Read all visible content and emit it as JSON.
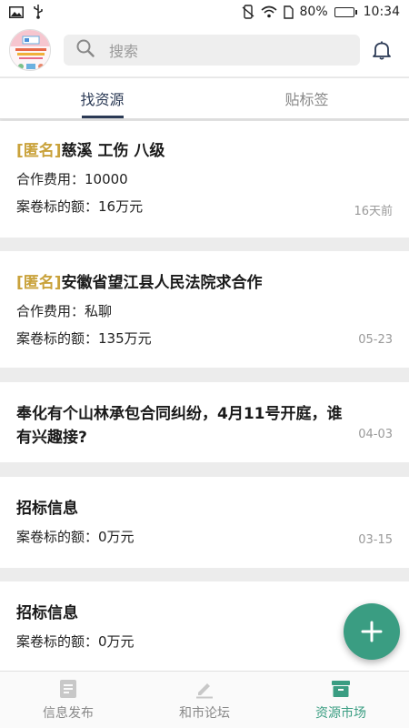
{
  "status_bar": {
    "battery_percent": "80%",
    "battery_level": 0.8,
    "time": "10:34",
    "icons_left": [
      "image-icon",
      "usb-icon"
    ],
    "icons_right": [
      "vibrate-icon",
      "wifi-icon",
      "sim-icon",
      "battery-icon"
    ]
  },
  "header": {
    "search_placeholder": "搜索"
  },
  "tabs": [
    {
      "label": "找资源",
      "active": true
    },
    {
      "label": "贴标签",
      "active": false
    }
  ],
  "cards": [
    {
      "anon": "[匿名]",
      "title": "慈溪 工伤 八级",
      "fee": "合作费用：10000",
      "amount": "案卷标的额：16万元",
      "date": "16天前"
    },
    {
      "anon": "[匿名]",
      "title": "安徽省望江县人民法院求合作",
      "fee": "合作费用：私聊",
      "amount": "案卷标的额：135万元",
      "date": "05-23"
    },
    {
      "anon": "",
      "title": "奉化有个山林承包合同纠纷，4月11号开庭，谁有兴趣接?",
      "date": "04-03"
    },
    {
      "anon": "",
      "title": "招标信息",
      "amount": "案卷标的额：0万元",
      "date": "03-15"
    },
    {
      "anon": "",
      "title": "招标信息",
      "amount": "案卷标的额：0万元"
    }
  ],
  "bottom_nav": [
    {
      "label": "信息发布",
      "icon": "document-icon",
      "active": false
    },
    {
      "label": "和市论坛",
      "icon": "pencil-icon",
      "active": false
    },
    {
      "label": "资源市场",
      "icon": "archive-icon",
      "active": true
    }
  ],
  "colors": {
    "accent": "#3a9d82",
    "tab_active": "#2b3a55",
    "anon_gold": "#c9a23b"
  }
}
